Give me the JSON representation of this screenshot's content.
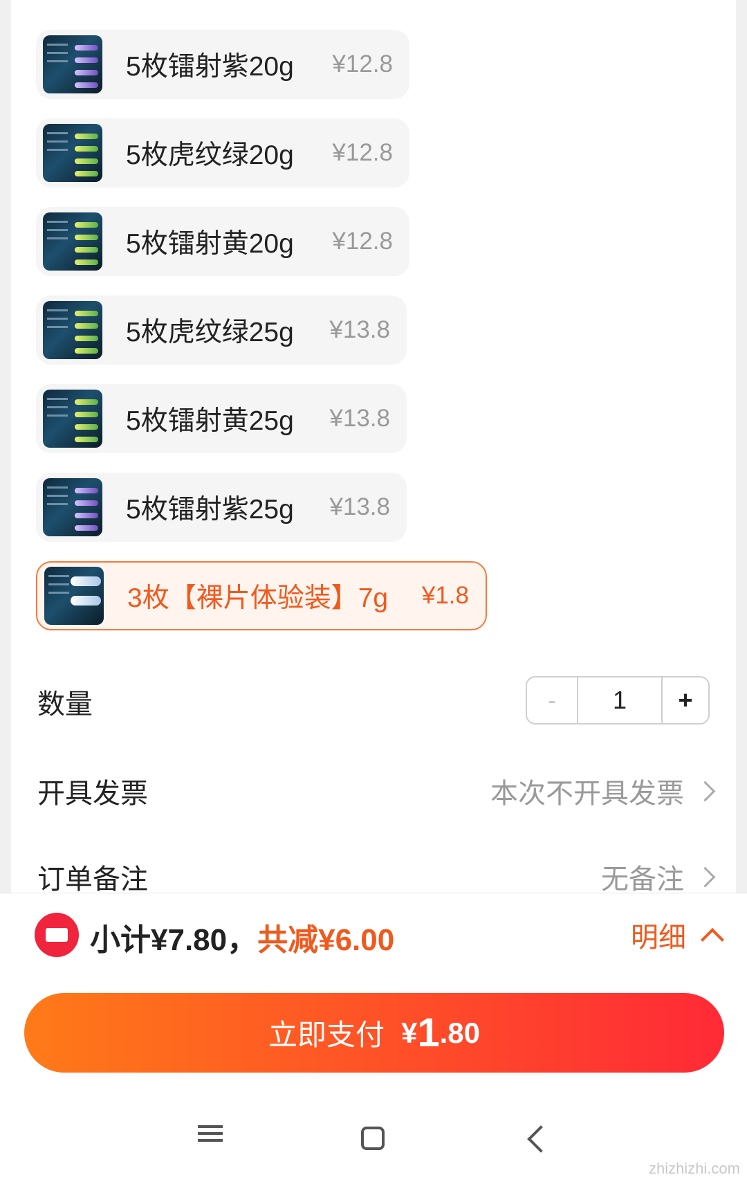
{
  "skus": [
    {
      "label": "5枚镭射紫20g",
      "price": "¥12.8"
    },
    {
      "label": "5枚虎纹绿20g",
      "price": "¥12.8"
    },
    {
      "label": "5枚镭射黄20g",
      "price": "¥12.8"
    },
    {
      "label": "5枚虎纹绿25g",
      "price": "¥13.8"
    },
    {
      "label": "5枚镭射黄25g",
      "price": "¥13.8"
    },
    {
      "label": "5枚镭射紫25g",
      "price": "¥13.8"
    },
    {
      "label": "3枚【裸片体验装】7g",
      "price": "¥1.8"
    }
  ],
  "quantity": {
    "label": "数量",
    "minus": "-",
    "value": "1",
    "plus": "+"
  },
  "invoice": {
    "label": "开具发票",
    "value": "本次不开具发票"
  },
  "note": {
    "label": "订单备注",
    "value": "无备注"
  },
  "summary": {
    "subtotal": "小计¥7.80，",
    "discount": "共减¥6.00",
    "detail": "明细"
  },
  "pay": {
    "label": "立即支付",
    "currency": "¥",
    "amount_int": "1",
    "amount_dec": ".80"
  },
  "watermark": "zhizhizhi.com"
}
